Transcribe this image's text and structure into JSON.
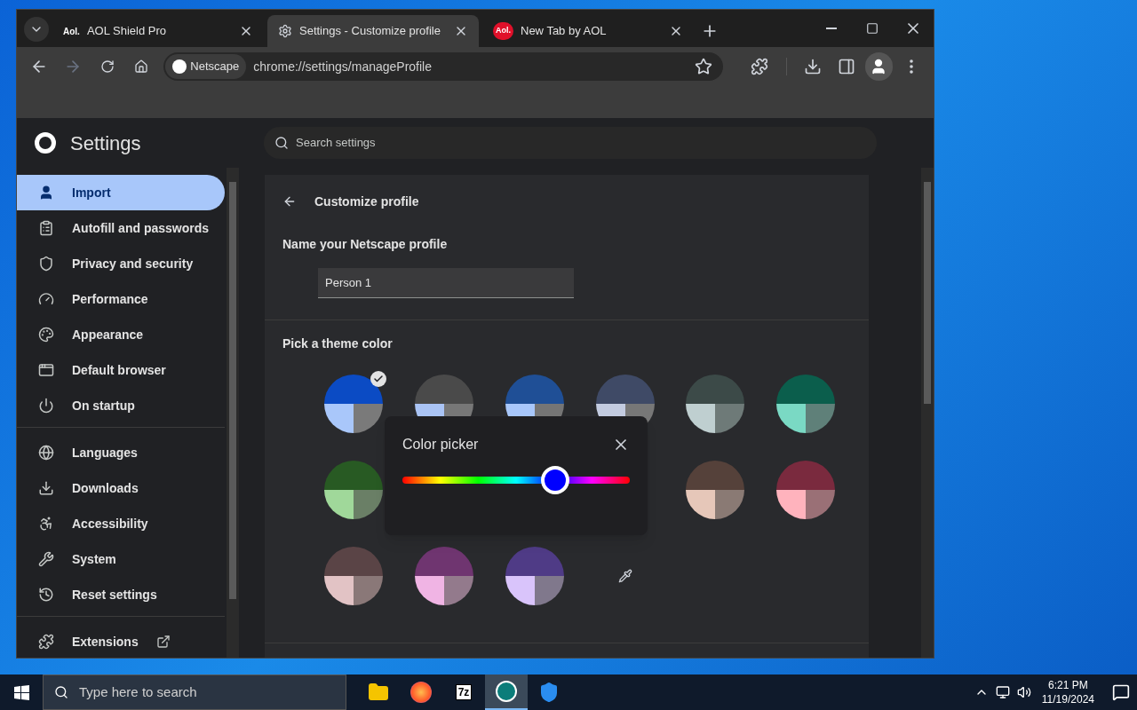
{
  "browser": {
    "tabs": [
      {
        "title": "AOL Shield Pro",
        "favicon_text": "Aol.",
        "kind": "aol",
        "selected": false
      },
      {
        "title": "Settings - Customize profile",
        "kind": "gear",
        "selected": true
      },
      {
        "title": "New Tab by AOL",
        "favicon_text": "Aol.",
        "kind": "aol-red",
        "selected": false
      }
    ],
    "toolbar": {
      "forward_disabled": true,
      "site_chip": "Netscape",
      "url": "chrome://settings/manageProfile"
    }
  },
  "settings": {
    "title": "Settings",
    "search": {
      "placeholder": "Search settings"
    },
    "sidebar": {
      "groups": [
        [
          {
            "label": "Import",
            "selected": true
          },
          {
            "label": "Autofill and passwords",
            "selected": false
          },
          {
            "label": "Privacy and security",
            "selected": false
          },
          {
            "label": "Performance",
            "selected": false
          },
          {
            "label": "Appearance",
            "selected": false
          },
          {
            "label": "Default browser",
            "selected": false
          },
          {
            "label": "On startup",
            "selected": false
          }
        ],
        [
          {
            "label": "Languages",
            "selected": false
          },
          {
            "label": "Downloads",
            "selected": false
          },
          {
            "label": "Accessibility",
            "selected": false
          },
          {
            "label": "System",
            "selected": false
          },
          {
            "label": "Reset settings",
            "selected": false
          }
        ],
        [
          {
            "label": "Extensions",
            "selected": false,
            "external": true
          }
        ]
      ]
    },
    "page": {
      "title": "Customize profile",
      "name_label": "Name your Netscape profile",
      "name_value": "Person 1",
      "theme_label": "Pick a theme color",
      "swatches": [
        {
          "kind": "swatch",
          "parts": [
            {
              "color": "#0b4bc4"
            },
            {
              "color": "#a9c7fa"
            },
            {
              "color": "#7a7a7a"
            }
          ],
          "selected": true
        },
        {
          "kind": "swatch",
          "parts": [
            {
              "color": "#4a4a4a"
            },
            {
              "color": "#aac4f5"
            },
            {
              "color": "#777777"
            }
          ],
          "selected": false
        },
        {
          "kind": "swatch",
          "parts": [
            {
              "color": "#1f4f96"
            },
            {
              "color": "#a8c7fa"
            },
            {
              "color": "#757575"
            }
          ],
          "selected": false
        },
        {
          "kind": "swatch",
          "parts": [
            {
              "color": "#3f4a66"
            },
            {
              "color": "#c3cbe0"
            },
            {
              "color": "#777777"
            }
          ],
          "selected": false
        },
        {
          "kind": "swatch",
          "parts": [
            {
              "color": "#3c4a48"
            },
            {
              "color": "#bfcfd0"
            },
            {
              "color": "#6e7a78"
            }
          ],
          "selected": false
        },
        {
          "kind": "swatch",
          "parts": [
            {
              "color": "#0b5e4c"
            },
            {
              "color": "#7ad9c4"
            },
            {
              "color": "#5f8079"
            }
          ],
          "selected": false
        },
        {
          "kind": "swatch",
          "parts": [
            {
              "color": "#285a23"
            },
            {
              "color": "#a0d89a"
            },
            {
              "color": "#6a7f66"
            }
          ],
          "selected": false
        },
        {
          "kind": "covered"
        },
        {
          "kind": "covered"
        },
        {
          "kind": "covered"
        },
        {
          "kind": "swatch",
          "parts": [
            {
              "color": "#55413a"
            },
            {
              "color": "#e6c7b9"
            },
            {
              "color": "#8a7a74"
            }
          ],
          "selected": false
        },
        {
          "kind": "swatch",
          "parts": [
            {
              "color": "#7a2a3e"
            },
            {
              "color": "#ffb3bd"
            },
            {
              "color": "#9a7076"
            }
          ],
          "selected": false
        },
        {
          "kind": "swatch",
          "parts": [
            {
              "color": "#5a4446"
            },
            {
              "color": "#e2c3c5"
            },
            {
              "color": "#8a7878"
            }
          ],
          "selected": false
        },
        {
          "kind": "swatch",
          "parts": [
            {
              "color": "#6f3570"
            },
            {
              "color": "#f0b4e4"
            },
            {
              "color": "#937a8c"
            }
          ],
          "selected": false
        },
        {
          "kind": "swatch",
          "parts": [
            {
              "color": "#4f3b86"
            },
            {
              "color": "#d9c4fb"
            },
            {
              "color": "#80788c"
            }
          ],
          "selected": false
        },
        {
          "kind": "eyedropper"
        }
      ],
      "picker": {
        "title": "Color picker",
        "level": 0.67,
        "color": "#0000ff"
      }
    }
  },
  "taskbar": {
    "search": {
      "placeholder": "Type here to search"
    },
    "apps": [
      {
        "kind": "folder",
        "active": false
      },
      {
        "kind": "firefox",
        "active": false
      },
      {
        "kind": "archiver",
        "text": "7z",
        "active": false
      },
      {
        "kind": "netscape",
        "active": true
      },
      {
        "kind": "shield",
        "active": false
      }
    ],
    "time": "6:21 PM",
    "date": "11/19/2024"
  }
}
